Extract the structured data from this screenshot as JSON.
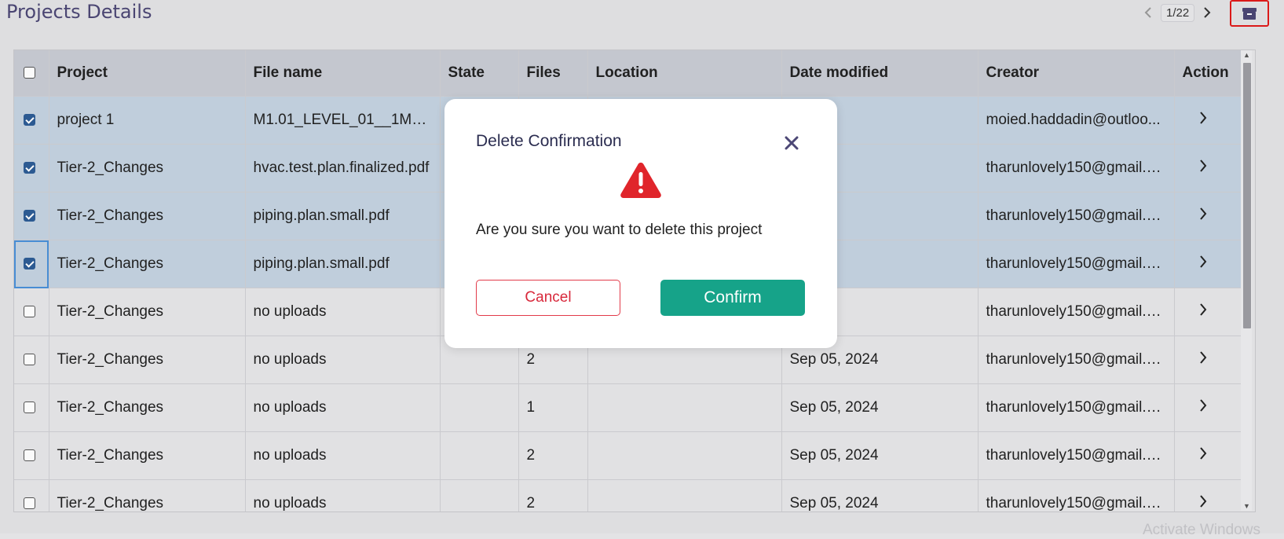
{
  "header": {
    "title": "Projects Details",
    "pagination": "1/22"
  },
  "table": {
    "columns": [
      "Project",
      "File name",
      "State",
      "Files",
      "Location",
      "Date modified",
      "Creator",
      "Action"
    ],
    "rows": [
      {
        "checked": true,
        "project": "project 1",
        "file": "M1.01_LEVEL_01__1M_M...",
        "state": "",
        "files": "",
        "location": "",
        "date": ", 2024",
        "creator": "moied.haddadin@outloo..."
      },
      {
        "checked": true,
        "project": "Tier-2_Changes",
        "file": "hvac.test.plan.finalized.pdf",
        "state": "",
        "files": "",
        "location": "",
        "date": ", 2024",
        "creator": "tharunlovely150@gmail.c..."
      },
      {
        "checked": true,
        "project": "Tier-2_Changes",
        "file": "piping.plan.small.pdf",
        "state": "",
        "files": "",
        "location": "",
        "date": ", 2024",
        "creator": "tharunlovely150@gmail.c..."
      },
      {
        "checked": true,
        "project": "Tier-2_Changes",
        "file": "piping.plan.small.pdf",
        "state": "",
        "files": "",
        "location": "",
        "date": ", 2024",
        "creator": "tharunlovely150@gmail.c..."
      },
      {
        "checked": false,
        "project": "Tier-2_Changes",
        "file": "no uploads",
        "state": "",
        "files": "",
        "location": "",
        "date": ", 2024",
        "creator": "tharunlovely150@gmail.c..."
      },
      {
        "checked": false,
        "project": "Tier-2_Changes",
        "file": "no uploads",
        "state": "",
        "files": "2",
        "location": "",
        "date": "Sep 05, 2024",
        "creator": "tharunlovely150@gmail.c..."
      },
      {
        "checked": false,
        "project": "Tier-2_Changes",
        "file": "no uploads",
        "state": "",
        "files": "1",
        "location": "",
        "date": "Sep 05, 2024",
        "creator": "tharunlovely150@gmail.c..."
      },
      {
        "checked": false,
        "project": "Tier-2_Changes",
        "file": "no uploads",
        "state": "",
        "files": "2",
        "location": "",
        "date": "Sep 05, 2024",
        "creator": "tharunlovely150@gmail.c..."
      },
      {
        "checked": false,
        "project": "Tier-2_Changes",
        "file": "no uploads",
        "state": "",
        "files": "2",
        "location": "",
        "date": "Sep 05, 2024",
        "creator": "tharunlovely150@gmail.c..."
      }
    ]
  },
  "modal": {
    "title": "Delete Confirmation",
    "message": "Are you sure you want to delete this project",
    "cancel_label": "Cancel",
    "confirm_label": "Confirm",
    "warning_icon": "warning-triangle-icon"
  },
  "watermark": "Activate Windows",
  "colors": {
    "title": "#4c4775",
    "selected_row": "#c4d3e1",
    "confirm": "#16a389",
    "cancel": "#d8283b",
    "warning": "#e0252b"
  }
}
